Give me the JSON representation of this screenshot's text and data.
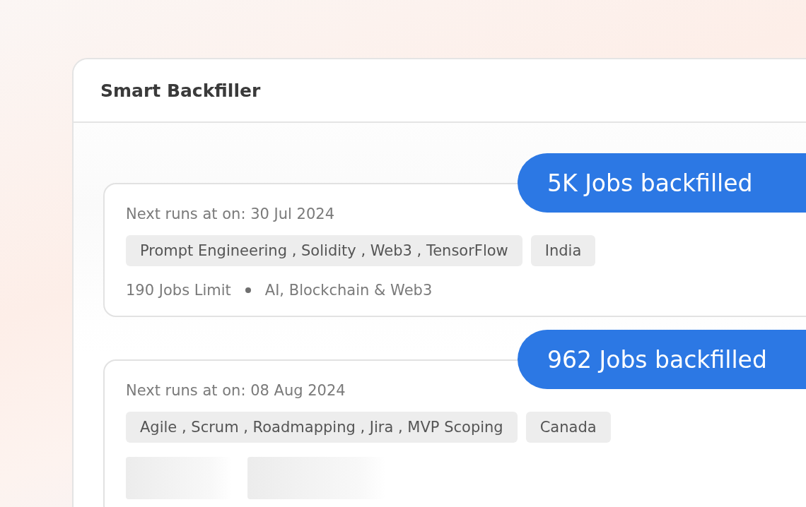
{
  "window": {
    "title": "Smart Backfiller"
  },
  "backfills": [
    {
      "kind": "details",
      "badge": "5K Jobs backfilled",
      "next_run": "Next runs at on: 30 Jul 2024",
      "tags": [
        "Prompt Engineering , Solidity , Web3 , TensorFlow",
        "India"
      ],
      "limit": "190 Jobs Limit",
      "category": "AI, Blockchain & Web3"
    },
    {
      "kind": "loading",
      "badge": "962 Jobs backfilled",
      "next_run": "Next runs at on: 08 Aug 2024",
      "tags": [
        "Agile , Scrum , Roadmapping , Jira , MVP Scoping",
        "Canada"
      ]
    }
  ]
}
